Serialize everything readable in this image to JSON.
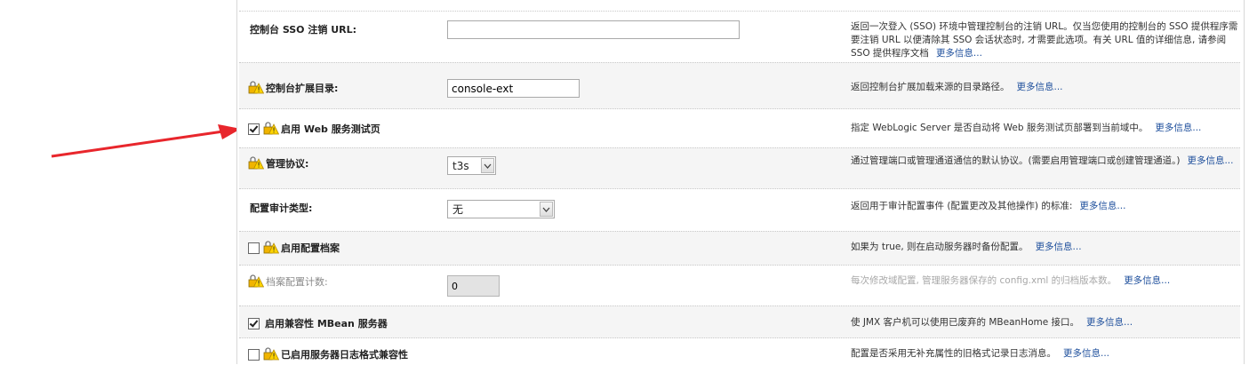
{
  "rows": [
    {
      "label": "控制台 SSO 注销 URL:",
      "value": "",
      "desc": "返回一次登入 (SSO) 环境中管理控制台的注销 URL。仅当您使用的控制台的 SSO 提供程序需要注销 URL 以便清除其 SSO 会话状态时, 才需要此选项。有关 URL 值的详细信息, 请参阅 SSO 提供程序文档",
      "more": "更多信息..."
    },
    {
      "label": "控制台扩展目录:",
      "value": "console-ext",
      "desc": "返回控制台扩展加载来源的目录路径。",
      "more": "更多信息..."
    },
    {
      "label": "启用 Web 服务测试页",
      "checked": true,
      "desc": "指定 WebLogic Server 是否自动将 Web 服务测试页部署到当前域中。",
      "more": "更多信息..."
    },
    {
      "label": "管理协议:",
      "value": "t3s",
      "desc": "通过管理端口或管理通道通信的默认协议。(需要启用管理端口或创建管理通道。)",
      "more": "更多信息..."
    },
    {
      "label": "配置审计类型:",
      "value": "无",
      "desc": "返回用于审计配置事件 (配置更改及其他操作) 的标准:",
      "more": "更多信息..."
    },
    {
      "label": "启用配置档案",
      "checked": false,
      "desc": "如果为 true, 则在启动服务器时备份配置。",
      "more": "更多信息..."
    },
    {
      "label": "档案配置计数:",
      "value": "0",
      "desc": "每次修改域配置, 管理服务器保存的 config.xml 的归档版本数。",
      "more": "更多信息..."
    },
    {
      "label": "启用兼容性 MBean 服务器",
      "checked": true,
      "desc": "使 JMX 客户机可以使用已废弃的 MBeanHome 接口。",
      "more": "更多信息..."
    },
    {
      "label": "已启用服务器日志格式兼容性",
      "checked": false,
      "desc": "配置是否采用无补充属性的旧格式记录日志消息。",
      "more": "更多信息..."
    }
  ],
  "icons": {
    "lock_warning": "lock-warning-icon",
    "pointer": "red-arrow-annotation"
  },
  "colors": {
    "link": "#1e4f9c",
    "annotation": "#e8262c",
    "lock": "#f0b400"
  }
}
